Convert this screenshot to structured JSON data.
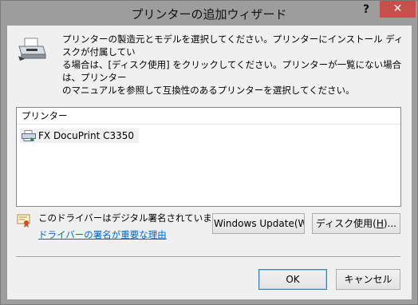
{
  "window": {
    "title": "プリンターの追加ウィザード",
    "help_label": "?",
    "close_label": "✕"
  },
  "instructions": {
    "line1": "プリンターの製造元とモデルを選択してください。プリンターにインストール ディスクが付属してい",
    "line2": "る場合は、[ディスク使用] をクリックしてください。プリンターが一覧にない場合は、プリンター",
    "line3": "のマニュアルを参照して互換性のあるプリンターを選択してください。"
  },
  "printer_list": {
    "header": "プリンター",
    "items": [
      {
        "label": "FX DocuPrint C3350",
        "icon": "printer-small-icon"
      }
    ]
  },
  "signature": {
    "status_text": "このドライバーはデジタル署名されています。",
    "link_text": "ドライバーの署名が重要な理由"
  },
  "buttons": {
    "windows_update": "Windows Update(W",
    "disk_prefix": "ディスク使用(",
    "disk_key": "H",
    "disk_suffix": ")...",
    "ok": "OK",
    "cancel": "キャンセル"
  },
  "colors": {
    "title_bar": "#9d9d9d",
    "close_button": "#c7504c",
    "dialog_background": "#f0f0f0",
    "link": "#0066cc"
  }
}
